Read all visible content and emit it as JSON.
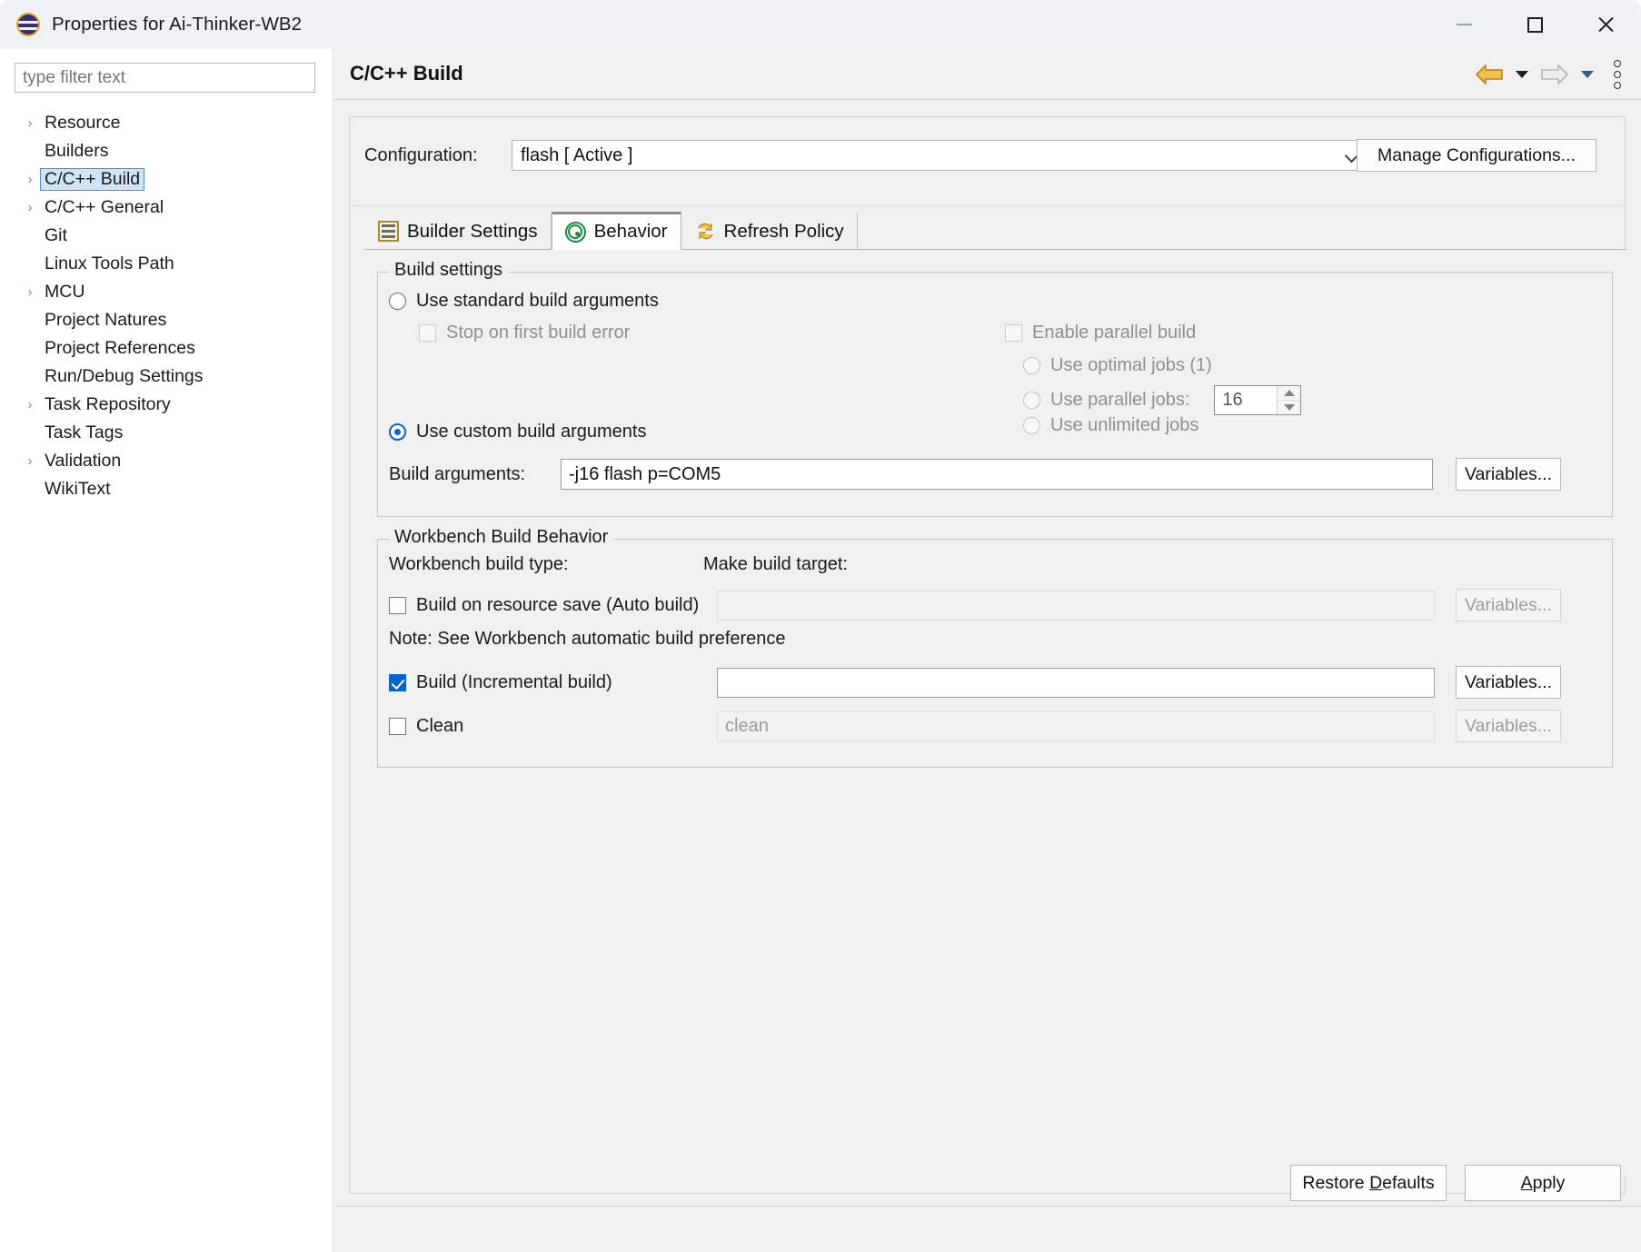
{
  "window": {
    "title": "Properties for Ai-Thinker-WB2",
    "logo_icon": "eclipse-logo-icon",
    "minimize_label": "—",
    "maximize_label": "□",
    "close_label": "✕"
  },
  "sidebar": {
    "filter_placeholder": "type filter text",
    "filter_value": "",
    "items": [
      {
        "label": "Resource",
        "expandable": true,
        "selected": false
      },
      {
        "label": "Builders",
        "expandable": false,
        "selected": false
      },
      {
        "label": "C/C++ Build",
        "expandable": true,
        "selected": true
      },
      {
        "label": "C/C++ General",
        "expandable": true,
        "selected": false
      },
      {
        "label": "Git",
        "expandable": false,
        "selected": false
      },
      {
        "label": "Linux Tools Path",
        "expandable": false,
        "selected": false
      },
      {
        "label": "MCU",
        "expandable": true,
        "selected": false
      },
      {
        "label": "Project Natures",
        "expandable": false,
        "selected": false
      },
      {
        "label": "Project References",
        "expandable": false,
        "selected": false
      },
      {
        "label": "Run/Debug Settings",
        "expandable": false,
        "selected": false
      },
      {
        "label": "Task Repository",
        "expandable": true,
        "selected": false
      },
      {
        "label": "Task Tags",
        "expandable": false,
        "selected": false
      },
      {
        "label": "Validation",
        "expandable": true,
        "selected": false
      },
      {
        "label": "WikiText",
        "expandable": false,
        "selected": false
      }
    ],
    "expand_arrow": "›"
  },
  "header": {
    "page_title": "C/C++ Build",
    "back_icon": "back-arrow-icon",
    "forward_icon": "forward-arrow-icon",
    "menu_icon": "vertical-dots-menu-icon"
  },
  "configuration": {
    "label": "Configuration:",
    "value": "flash  [ Active ]",
    "manage_button": "Manage Configurations..."
  },
  "tabs": [
    {
      "label": "Builder Settings",
      "icon": "builder-settings-icon",
      "active": false
    },
    {
      "label": "Behavior",
      "icon": "behavior-target-icon",
      "active": true
    },
    {
      "label": "Refresh Policy",
      "icon": "refresh-policy-icon",
      "active": false
    }
  ],
  "build_settings": {
    "group_title": "Build settings",
    "use_standard": {
      "label": "Use standard build arguments",
      "checked": false
    },
    "stop_on_error": {
      "label": "Stop on first build error",
      "checked": false,
      "enabled": false
    },
    "enable_parallel": {
      "label": "Enable parallel build",
      "checked": false,
      "enabled": false
    },
    "optimal_jobs": {
      "label": "Use optimal jobs (1)",
      "checked": false,
      "enabled": false
    },
    "parallel_jobs": {
      "label": "Use parallel jobs:",
      "checked": false,
      "enabled": false,
      "value": "16"
    },
    "unlimited_jobs": {
      "label": "Use unlimited jobs",
      "checked": false,
      "enabled": false
    },
    "use_custom": {
      "label": "Use custom build arguments",
      "checked": true
    },
    "build_args_label": "Build arguments:",
    "build_args_value": "-j16 flash p=COM5",
    "variables_button": "Variables..."
  },
  "workbench": {
    "group_title": "Workbench Build Behavior",
    "build_type_label": "Workbench build type:",
    "make_target_label": "Make build target:",
    "auto_build": {
      "label": "Build on resource save (Auto build)",
      "checked": false,
      "target": "",
      "variables": "Variables...",
      "enabled": false
    },
    "note": "Note: See Workbench automatic build preference",
    "incremental": {
      "label": "Build (Incremental build)",
      "checked": true,
      "target": "",
      "variables": "Variables...",
      "enabled": true
    },
    "clean": {
      "label": "Clean",
      "checked": false,
      "target": "clean",
      "variables": "Variables...",
      "enabled": false
    }
  },
  "footer": {
    "restore_defaults": "Restore Defaults",
    "restore_defaults_mnemonic": "D",
    "apply": "Apply",
    "apply_mnemonic": "A"
  },
  "colors": {
    "accent": "#0a64c8",
    "selection_bg": "#cfe4f7",
    "selection_border": "#4a90d9",
    "panel_bg": "#f0f0f0",
    "titlebar_bg": "#eef2f7",
    "nav_back": "#d6a327",
    "nav_forward": "#b8b8b8",
    "tab_icon_green": "#17893f"
  }
}
